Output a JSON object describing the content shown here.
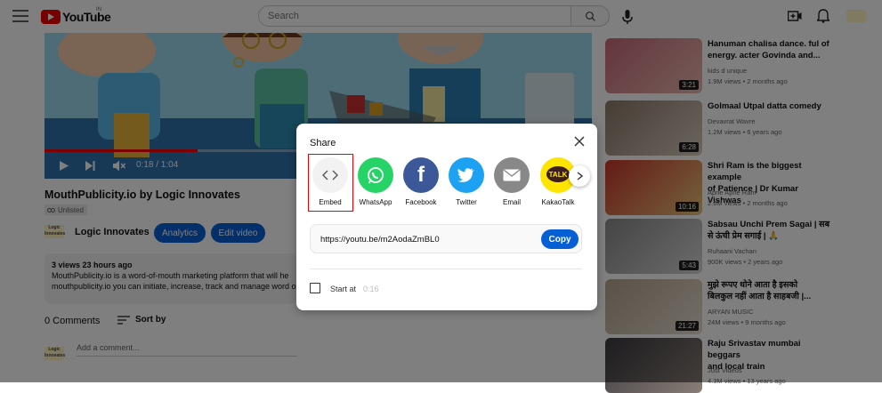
{
  "header": {
    "logo_text": "YouTube",
    "region": "IN",
    "search_placeholder": "Search"
  },
  "player": {
    "time": "0:18 / 1:04",
    "progress": 0.28
  },
  "video": {
    "title": "MouthPublicity.io by Logic Innovates",
    "visibility": "Unlisted",
    "channel_logo_text": "Logic Innovates",
    "channel": "Logic Innovates",
    "analytics_label": "Analytics",
    "edit_label": "Edit video",
    "stats": "3 views  23 hours ago",
    "desc_line1": "MouthPublicity.io is a word-of-mouth marketing platform that will he",
    "desc_line2": "mouthpublicity.io you can initiate, increase, track and manage word o",
    "comments": "0 Comments",
    "sort_by": "Sort by",
    "add_comment": "Add a comment..."
  },
  "share_dialog": {
    "title": "Share",
    "items": [
      {
        "label": "Embed",
        "icon": "embed-icon",
        "color": "#f2f2f2"
      },
      {
        "label": "WhatsApp",
        "icon": "whatsapp-icon",
        "color": "#25d366"
      },
      {
        "label": "Facebook",
        "icon": "facebook-icon",
        "color": "#3b5998"
      },
      {
        "label": "Twitter",
        "icon": "twitter-icon",
        "color": "#1da1f2"
      },
      {
        "label": "Email",
        "icon": "email-icon",
        "color": "#888888"
      },
      {
        "label": "KakaoTalk",
        "icon": "kakaotalk-icon",
        "color": "#fee500"
      }
    ],
    "url": "https://youtu.be/m2AodaZmBL0",
    "copy_label": "Copy",
    "start_at_label": "Start at",
    "start_time": "0:16"
  },
  "recommendations": [
    {
      "title_line1": "Hanuman chalisa dance. ful of",
      "title_line2": "energy. acter Govinda and...",
      "channel": "kids d unique",
      "meta": "1.9M views • 2 months ago",
      "duration": "3:21"
    },
    {
      "title_line1": "Golmaal Utpal datta comedy",
      "title_line2": "",
      "channel": "Devavrat Wavre",
      "meta": "1.2M views • 6 years ago",
      "duration": "6:28"
    },
    {
      "title_line1": "Shri Ram is the biggest example",
      "title_line2": "of Patience | Dr Kumar Vishwas",
      "channel": "Apne Apne Ram",
      "meta": "2.6M views • 2 months ago",
      "duration": "10:16"
    },
    {
      "title_line1": "Sabsau Unchi Prem Sagai | सब",
      "title_line2": "से ऊंची प्रेम सगाई | 🙏",
      "channel": "Ruhaani Vachan",
      "meta": "900K views • 2 years ago",
      "duration": "5:43"
    },
    {
      "title_line1": "मुझे रूपए धोने आता है इसको",
      "title_line2": "बिलकुल नहीं आता है साहबजी |...",
      "channel": "ARYAN MUSIC",
      "meta": "24M views • 9 months ago",
      "duration": "21:27"
    },
    {
      "title_line1": "Raju Srivastav mumbai beggars",
      "title_line2": "and local train",
      "channel": "Just Videos",
      "meta": "4.3M views • 13 years ago",
      "duration": ""
    }
  ],
  "colors": {
    "brand_red": "#ff0000",
    "accent_blue": "#065fd4"
  }
}
